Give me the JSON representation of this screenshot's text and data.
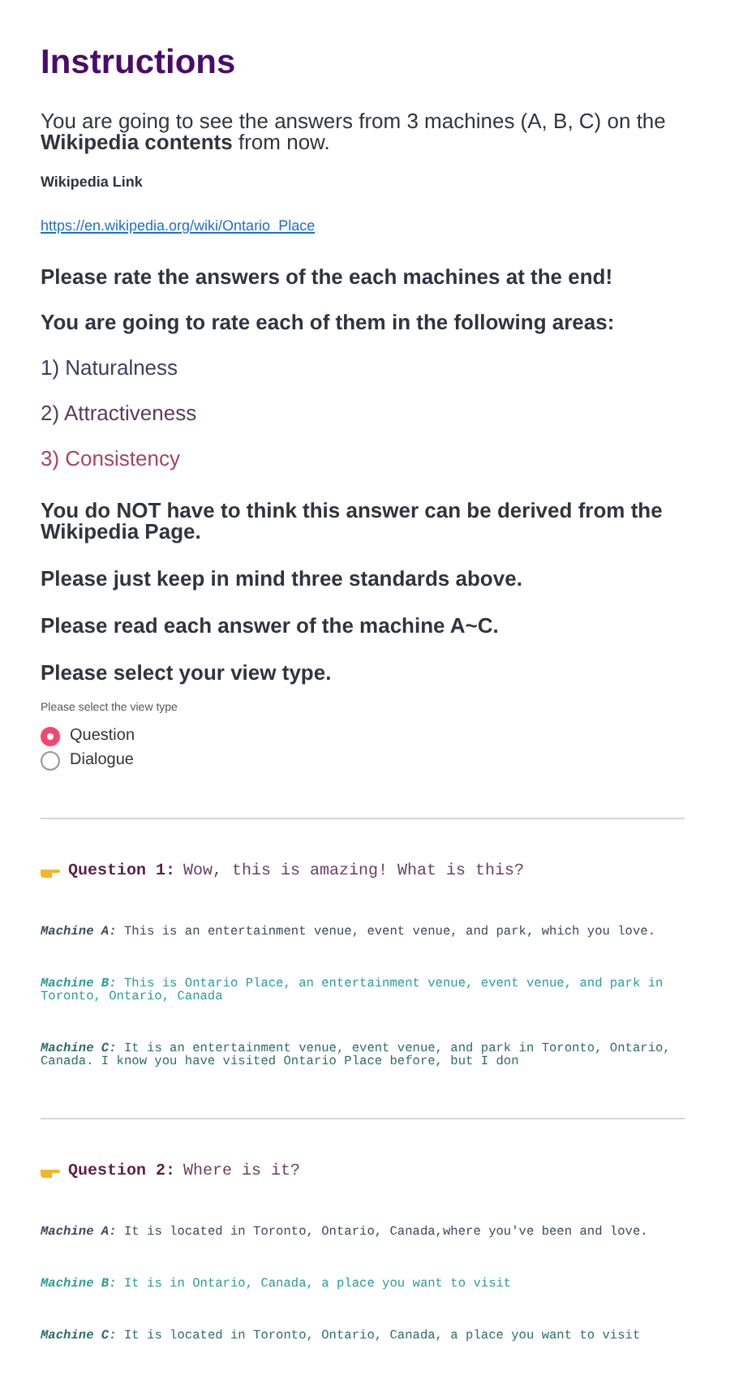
{
  "title": "Instructions",
  "intro": "You are going to see the answers from 3 machines (A, B, C) on the **Wikipedia contents** from now.",
  "link_label": "Wikipedia Link",
  "link": "https://en.wikipedia.org/wiki/Ontario_Place",
  "notes_before": [
    "Please rate the answers of the each machines at the end!",
    "You are going to rate each of them in the following areas:"
  ],
  "criteria": [
    {
      "text": "1) Naturalness",
      "color": "#3d3d5c"
    },
    {
      "text": "2) Attractiveness",
      "color": "#5a3a5e"
    },
    {
      "text": "3) Consistency",
      "color": "#a8445e"
    }
  ],
  "notes_after": [
    "You do NOT have to think this answer can be derived from the Wikipedia Page.",
    "Please just keep in mind three standards above.",
    "Please read each answer of the machine A~C.",
    "Please select your view type."
  ],
  "view_type": {
    "label": "Please select the view type",
    "options": [
      {
        "label": "Question",
        "selected": true
      },
      {
        "label": "Dialogue",
        "selected": false
      }
    ]
  },
  "questions": [
    {
      "label": "Question 1:",
      "text": "Wow, this is amazing! What is this?",
      "answers": [
        {
          "machine": "Machine A:",
          "text": "This is an entertainment venue, event venue, and park, which you love.",
          "color": "#3d4a5c"
        },
        {
          "machine": "Machine B:",
          "text": "This is Ontario Place, an entertainment venue, event venue, and park in Toronto, Ontario, Canada",
          "color": "#2a9d9a"
        },
        {
          "machine": "Machine C:",
          "text": "It is an entertainment venue, event venue, and park in Toronto, Ontario, Canada. I know you have visited Ontario Place before, but I don",
          "color": "#2d6e6a"
        }
      ]
    },
    {
      "label": "Question 2:",
      "text": "Where is it?",
      "answers": [
        {
          "machine": "Machine A:",
          "text": "It is located in Toronto, Ontario, Canada,where you've been and love.",
          "color": "#3d4a5c"
        },
        {
          "machine": "Machine B:",
          "text": "It is in Ontario, Canada, a place you want to visit",
          "color": "#2a9d9a"
        },
        {
          "machine": "Machine C:",
          "text": "It is located in Toronto, Ontario, Canada, a place you want to visit",
          "color": "#2d6e6a"
        }
      ]
    }
  ]
}
